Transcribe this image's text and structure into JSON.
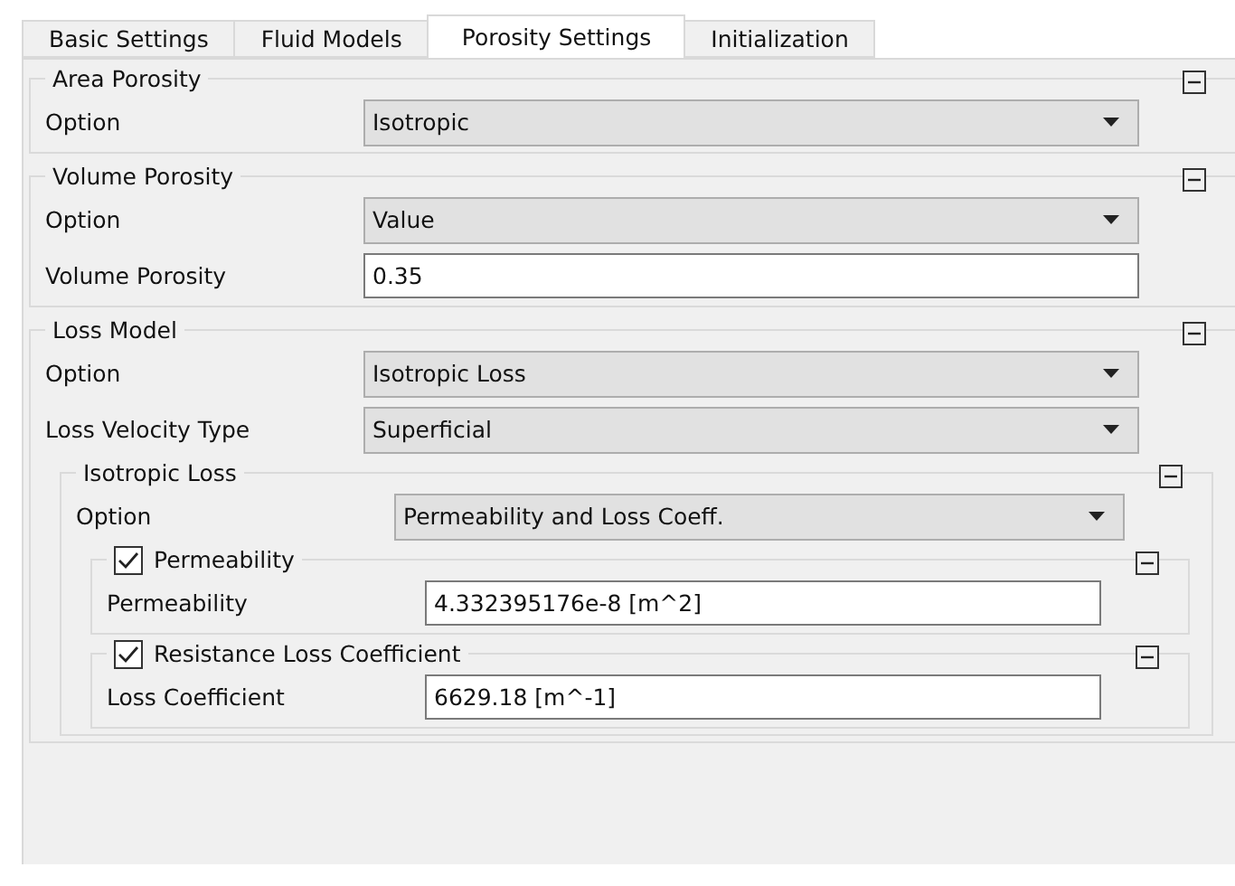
{
  "tabs": [
    {
      "label": "Basic Settings",
      "selected": false
    },
    {
      "label": "Fluid Models",
      "selected": false
    },
    {
      "label": "Porosity Settings",
      "selected": true
    },
    {
      "label": "Initialization",
      "selected": false
    }
  ],
  "groups": [
    {
      "title": "Area Porosity",
      "expanded": true,
      "rows": [
        {
          "kind": "dropdown",
          "label": "Option",
          "value": "Isotropic"
        }
      ]
    },
    {
      "title": "Volume Porosity",
      "expanded": true,
      "rows": [
        {
          "kind": "dropdown",
          "label": "Option",
          "value": "Value"
        },
        {
          "kind": "input",
          "label": "Volume Porosity",
          "value": "0.35"
        }
      ]
    },
    {
      "title": "Loss Model",
      "expanded": true,
      "rows": [
        {
          "kind": "dropdown",
          "label": "Option",
          "value": "Isotropic Loss"
        },
        {
          "kind": "dropdown",
          "label": "Loss Velocity Type",
          "value": "Superficial"
        }
      ],
      "children": [
        {
          "title": "Isotropic Loss",
          "expanded": true,
          "rows": [
            {
              "kind": "dropdown",
              "label": "Option",
              "value": "Permeability and Loss Coeff."
            }
          ],
          "children": [
            {
              "title": "Permeability",
              "checked": true,
              "expanded": true,
              "rows": [
                {
                  "kind": "input",
                  "label": "Permeability",
                  "value": "4.332395176e-8 [m^2]"
                }
              ]
            },
            {
              "title": "Resistance Loss Coefficient",
              "checked": true,
              "expanded": true,
              "rows": [
                {
                  "kind": "input",
                  "label": "Loss Coefficient",
                  "value": "6629.18 [m^-1]"
                }
              ]
            }
          ]
        }
      ]
    }
  ]
}
